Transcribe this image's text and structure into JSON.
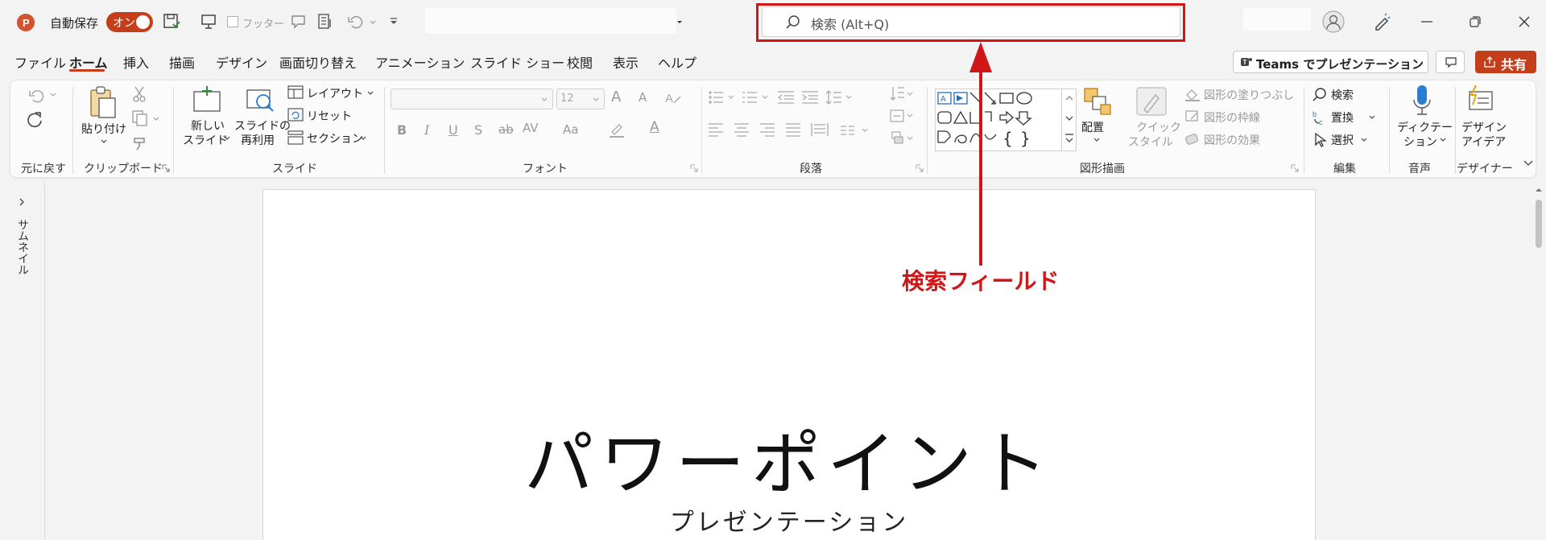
{
  "titlebar": {
    "autosave_label": "自動保存",
    "autosave_toggle": "オン",
    "footer_label": "フッター"
  },
  "search": {
    "placeholder": "検索 (Alt+Q)"
  },
  "tabs": [
    "ファイル",
    "ホーム",
    "挿入",
    "描画",
    "デザイン",
    "画面切り替え",
    "アニメーション",
    "スライド ショー",
    "校閲",
    "表示",
    "ヘルプ"
  ],
  "actions": {
    "teams_label": "Teams でプレゼンテーション",
    "share_label": "共有"
  },
  "ribbon": {
    "undo": {
      "group": "元に戻す"
    },
    "clipboard": {
      "paste": "貼り付け",
      "group": "クリップボード"
    },
    "slides": {
      "new_slide_1": "新しい",
      "new_slide_2": "スライド",
      "reuse_1": "スライドの",
      "reuse_2": "再利用",
      "layout": "レイアウト",
      "reset": "リセット",
      "section": "セクション",
      "group": "スライド"
    },
    "font": {
      "size": "12",
      "group": "フォント",
      "b": "B",
      "i": "I",
      "u": "U",
      "s": "S",
      "ab": "ab",
      "av": "AV",
      "aa": "Aa",
      "grow": "A",
      "shrink": "A",
      "color": "A"
    },
    "paragraph": {
      "group": "段落"
    },
    "drawing": {
      "arrange": "配置",
      "quick_style_1": "クイック",
      "quick_style_2": "スタイル",
      "fill": "図形の塗りつぶし",
      "outline": "図形の枠線",
      "effects": "図形の効果",
      "group": "図形描画"
    },
    "editing": {
      "find": "検索",
      "replace": "置換",
      "select": "選択",
      "group": "編集"
    },
    "voice": {
      "dictate_1": "ディクテー",
      "dictate_2": "ション",
      "group": "音声"
    },
    "designer": {
      "idea_1": "デザイン",
      "idea_2": "アイデア",
      "group": "デザイナー"
    }
  },
  "thumbnail_pane": {
    "label": "サムネイル"
  },
  "slide": {
    "title": "パワーポイント",
    "subtitle": "プレゼンテーション"
  },
  "annotation": {
    "label": "検索フィールド"
  },
  "colors": {
    "accent": "#c43e1c",
    "annotation": "#d01616"
  }
}
